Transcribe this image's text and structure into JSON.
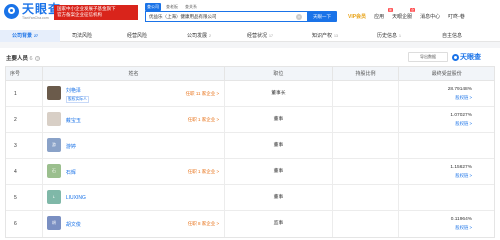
{
  "header": {
    "logo_cn": "天眼查",
    "logo_en": "TianYanCha.com",
    "promo_line1": "国家中小企业发展子基金旗下",
    "promo_line2": "官方备案企业征信机构",
    "search_tabs": [
      "查公司",
      "查老板",
      "查关系"
    ],
    "search_value": "优益乐（上海）健康用品有限公司",
    "search_clear": "×",
    "search_button": "天眼一下",
    "nav": {
      "vip": "VIP会员",
      "app": "应用",
      "app_badge": "新",
      "enterprise": "天眼企服",
      "enterprise_badge": "企",
      "messages": "消息中心",
      "user": "叮咚-巷"
    }
  },
  "tabs": [
    {
      "label": "公司背景",
      "count": "27"
    },
    {
      "label": "司法风险",
      "count": ""
    },
    {
      "label": "经营风险",
      "count": ""
    },
    {
      "label": "公司发展",
      "count": "2"
    },
    {
      "label": "经营状况",
      "count": "17"
    },
    {
      "label": "知识产权",
      "count": "13"
    },
    {
      "label": "历史信息",
      "count": "1"
    },
    {
      "label": "自主信息",
      "count": ""
    }
  ],
  "section": {
    "title": "主要人员",
    "count": "6",
    "info_icon": "?",
    "export_label": "导出数据",
    "brand": "天眼查"
  },
  "table": {
    "headers": [
      "序号",
      "姓名",
      "职位",
      "持股比例",
      "最终受益股份"
    ],
    "rows": [
      {
        "index": "1",
        "avatar": "",
        "avatar_color": "#6b5b4b",
        "name": "刘艳泽",
        "tag": "股权实际人",
        "related": "任职 11 家企业 >",
        "role": "董事长",
        "ratio": "28.79148%",
        "path": "股权链 >"
      },
      {
        "index": "2",
        "avatar": "",
        "avatar_color": "#d8cfc6",
        "name": "戴宝玉",
        "tag": "",
        "related": "任职 1 家企业 >",
        "role": "董事",
        "ratio": "1.07027%",
        "path": "股权链 >"
      },
      {
        "index": "3",
        "avatar": "游",
        "avatar_color": "#8aa2c8",
        "name": "游婷",
        "tag": "",
        "related": "",
        "role": "董事",
        "ratio": "",
        "path": ""
      },
      {
        "index": "4",
        "avatar": "石",
        "avatar_color": "#9bbf8e",
        "name": "石辉",
        "tag": "",
        "related": "任职 1 家企业 >",
        "role": "董事",
        "ratio": "1.15627%",
        "path": "股权链 >"
      },
      {
        "index": "5",
        "avatar": "L",
        "avatar_color": "#7fb8a8",
        "name": "LIUXING",
        "tag": "",
        "related": "",
        "role": "董事",
        "ratio": "",
        "path": ""
      },
      {
        "index": "6",
        "avatar": "胡",
        "avatar_color": "#7a8fc2",
        "name": "胡文俊",
        "tag": "",
        "related": "任职 8 家企业 >",
        "role": "监事",
        "ratio": "0.11964%",
        "path": "股权链 >"
      }
    ]
  }
}
